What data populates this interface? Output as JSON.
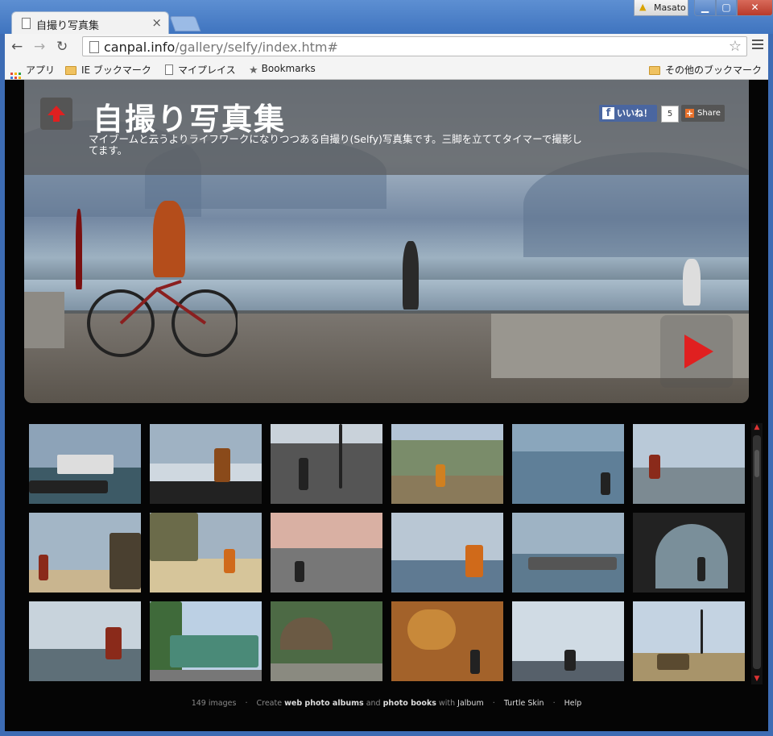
{
  "browser": {
    "tab_title": "自撮り写真集",
    "user_name": "Masato",
    "url_host": "canpal.info",
    "url_path": "/gallery/selfy/index.htm#"
  },
  "bookmarks": {
    "apps": "アプリ",
    "ie": "IE ブックマーク",
    "myplace": "マイプレイス",
    "bookmarks": "Bookmarks",
    "other": "その他のブックマーク"
  },
  "album": {
    "title": "自撮り写真集",
    "description": "マイブームと云うよりライフワークになりつつある自撮り(Selfy)写真集です。三脚を立ててタイマーで撮影してます。",
    "like_label": "いいね！",
    "like_count": "5",
    "share_label": "Share"
  },
  "footer": {
    "count": "149 images",
    "create": "Create",
    "web_albums": "web photo albums",
    "and": "and",
    "photo_books": "photo books",
    "with": "with",
    "jalbum": "Jalbum",
    "skin": "Turtle Skin",
    "help": "Help"
  },
  "colors": {
    "accent_red": "#e02020",
    "page_bg": "#050505",
    "fb_blue": "#4a66a0"
  }
}
